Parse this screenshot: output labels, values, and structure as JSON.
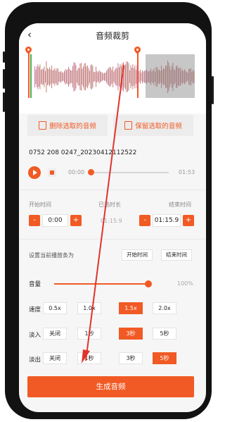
{
  "header": {
    "back_glyph": "‹",
    "title": "音频裁剪"
  },
  "actions": {
    "delete_label": "删除选取的音频",
    "keep_label": "保留选取的音频"
  },
  "file": {
    "name": "0752 208 0247_20230412112522"
  },
  "player": {
    "current": "00:00",
    "total": "01:53",
    "progress": 0.0
  },
  "trim": {
    "start_label": "开始时间",
    "selected_label": "已选时长",
    "end_label": "结束时间",
    "start_value": "0:00",
    "selected_value": "01:15.9",
    "end_value": "01:15.9",
    "minus": "-",
    "plus": "+"
  },
  "playback": {
    "label": "设置当前播放条为",
    "start_btn": "开始时间",
    "end_btn": "结束时间"
  },
  "volume": {
    "label": "音量",
    "value": "100%",
    "level": 1.0
  },
  "speed": {
    "label": "速度",
    "options": [
      "0.5x",
      "1.0x",
      "1.5x",
      "2.0x"
    ],
    "selected": "1.5x"
  },
  "fade_in": {
    "label": "淡入",
    "options": [
      "关闭",
      "1秒",
      "3秒",
      "5秒"
    ],
    "selected": "3秒"
  },
  "fade_out": {
    "label": "淡出",
    "options": [
      "关闭",
      "1秒",
      "3秒",
      "5秒"
    ],
    "selected": "5秒"
  },
  "generate": {
    "label": "生成音频"
  },
  "colors": {
    "accent": "#f15a24",
    "annotation_arrow": "#e0342a"
  }
}
